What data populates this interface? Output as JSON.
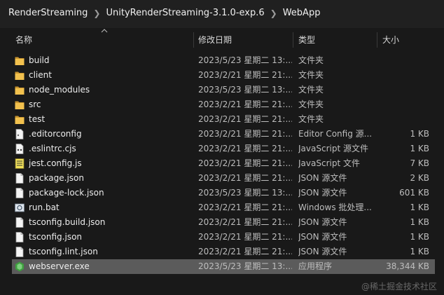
{
  "breadcrumb": [
    "RenderStreaming",
    "UnityRenderStreaming-3.1.0-exp.6",
    "WebApp"
  ],
  "columns": {
    "name": "名称",
    "date": "修改日期",
    "type": "类型",
    "size": "大小"
  },
  "files": [
    {
      "name": "build",
      "date": "2023/5/23 星期二 13:...",
      "type": "文件夹",
      "size": "",
      "icon": "folder-icon"
    },
    {
      "name": "client",
      "date": "2023/2/21 星期二 21:...",
      "type": "文件夹",
      "size": "",
      "icon": "folder-icon"
    },
    {
      "name": "node_modules",
      "date": "2023/5/23 星期二 13:...",
      "type": "文件夹",
      "size": "",
      "icon": "folder-icon"
    },
    {
      "name": "src",
      "date": "2023/2/21 星期二 21:...",
      "type": "文件夹",
      "size": "",
      "icon": "folder-icon"
    },
    {
      "name": "test",
      "date": "2023/2/21 星期二 21:...",
      "type": "文件夹",
      "size": "",
      "icon": "folder-icon"
    },
    {
      "name": ".editorconfig",
      "date": "2023/2/21 星期二 21:...",
      "type": "Editor Config 源...",
      "size": "1 KB",
      "icon": "config-file-icon"
    },
    {
      "name": ".eslintrc.cjs",
      "date": "2023/2/21 星期二 21:...",
      "type": "JavaScript 源文件",
      "size": "1 KB",
      "icon": "script-file-icon"
    },
    {
      "name": "jest.config.js",
      "date": "2023/2/21 星期二 21:...",
      "type": "JavaScript 文件",
      "size": "7 KB",
      "icon": "js-file-icon"
    },
    {
      "name": "package.json",
      "date": "2023/2/21 星期二 21:...",
      "type": "JSON 源文件",
      "size": "2 KB",
      "icon": "file-icon"
    },
    {
      "name": "package-lock.json",
      "date": "2023/5/23 星期二 13:...",
      "type": "JSON 源文件",
      "size": "601 KB",
      "icon": "file-icon"
    },
    {
      "name": "run.bat",
      "date": "2023/2/21 星期二 21:...",
      "type": "Windows 批处理...",
      "size": "1 KB",
      "icon": "batch-file-icon"
    },
    {
      "name": "tsconfig.build.json",
      "date": "2023/2/21 星期二 21:...",
      "type": "JSON 源文件",
      "size": "1 KB",
      "icon": "file-icon"
    },
    {
      "name": "tsconfig.json",
      "date": "2023/2/21 星期二 21:...",
      "type": "JSON 源文件",
      "size": "1 KB",
      "icon": "file-icon"
    },
    {
      "name": "tsconfig.lint.json",
      "date": "2023/2/21 星期二 21:...",
      "type": "JSON 源文件",
      "size": "1 KB",
      "icon": "file-icon"
    },
    {
      "name": "webserver.exe",
      "date": "2023/5/23 星期二 13:...",
      "type": "应用程序",
      "size": "38,344 KB",
      "icon": "exe-icon",
      "selected": true
    }
  ],
  "watermark": "@稀土掘金技术社区",
  "colors": {
    "background": "#191919",
    "selected_row": "#5b5b5b",
    "folder": "#e8b744"
  }
}
